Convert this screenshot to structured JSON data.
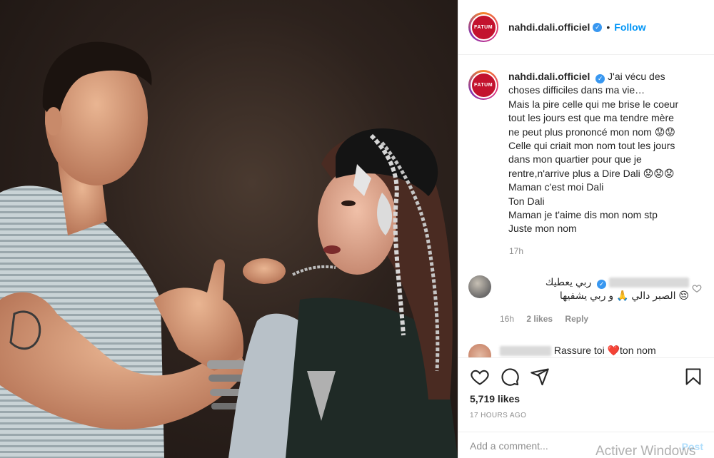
{
  "post": {
    "username": "nahdi.dali.officiel",
    "avatar_label": "FATUM",
    "verified_mark": "✓",
    "dot": "•",
    "follow_label": "Follow",
    "caption_lines": [
      "J'ai vécu des",
      "choses difficiles dans ma vie…",
      "Mais la pire celle qui me brise le coeur",
      "tout les jours est que ma tendre mère",
      "ne peut plus prononcé mon nom 😟😟",
      "Celle qui criait mon nom tout les jours",
      "dans mon quartier pour que je",
      "rentre,n'arrive plus a Dire Dali 😟😟😟",
      "Maman c'est moi Dali",
      "Ton Dali",
      "Maman je t'aime dis mon nom stp",
      "Juste mon nom"
    ],
    "caption_time": "17h"
  },
  "comments": [
    {
      "text_line1": "ربي يعطيك",
      "text_line2": "الصبر دالي 🙏 و ربي يشفيها 😔",
      "time": "16h",
      "likes": "2 likes",
      "reply": "Reply"
    },
    {
      "text_pre": "Rassure toi ",
      "heart": "❤️",
      "text_post": "ton nom"
    }
  ],
  "actions": {
    "likes": "5,719 likes",
    "time_ago": "17 HOURS AGO",
    "add_comment_placeholder": "Add a comment...",
    "post_label": "Post",
    "icons": [
      "heart-icon",
      "comment-icon",
      "share-icon",
      "bookmark-icon"
    ]
  },
  "overlay": {
    "watermark": "Activer Windows"
  },
  "colors": {
    "accent": "#0095f6",
    "verified": "#3897f0",
    "like_red": "#ed4956",
    "muted": "#8e8e8e",
    "text": "#262626"
  }
}
